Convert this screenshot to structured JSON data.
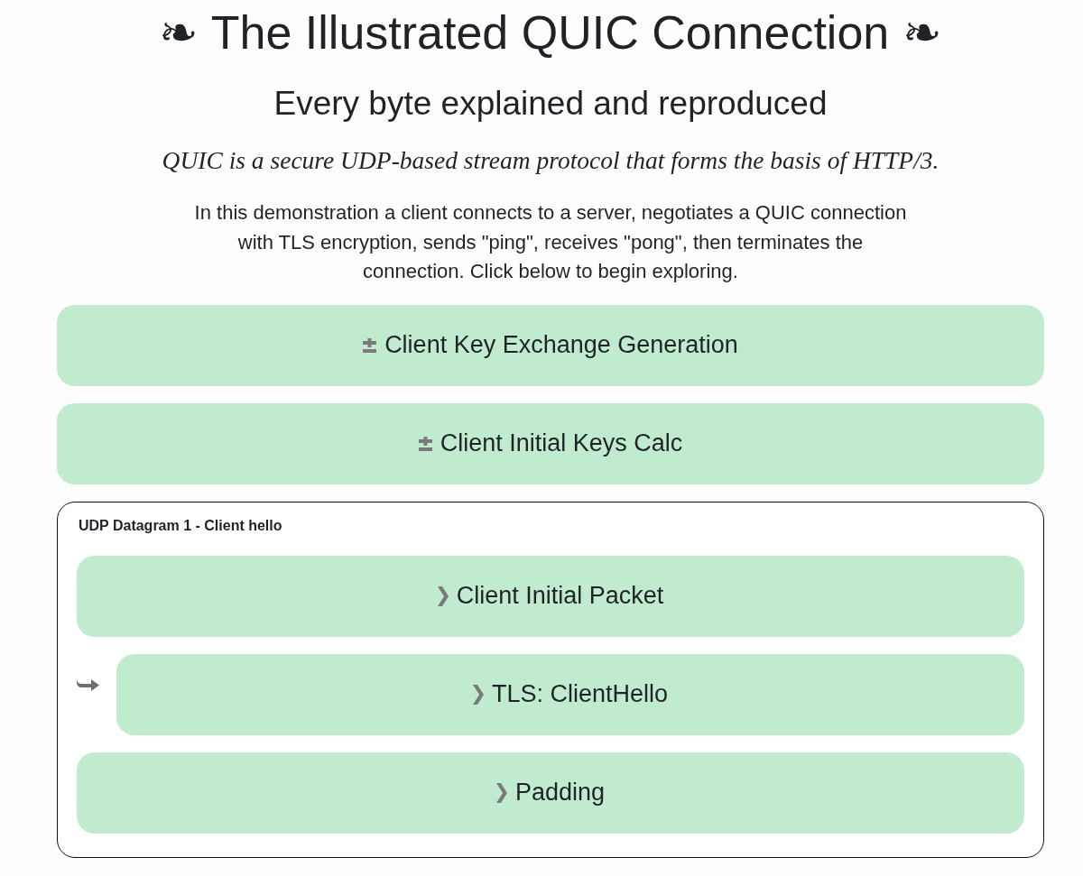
{
  "header": {
    "title": "❧ The Illustrated QUIC Connection ❧",
    "subtitle": "Every byte explained and reproduced",
    "tagline": "QUIC is a secure UDP-based stream protocol that forms the basis of HTTP/3.",
    "intro": "In this demonstration a client connects to a server, negotiates a QUIC connection with TLS encryption, sends \"ping\", receives \"pong\", then terminates the connection. Click below to begin exploring."
  },
  "sections": [
    {
      "kind": "calculation",
      "label": "Client Key Exchange Generation"
    },
    {
      "kind": "calculation",
      "label": "Client Initial Keys Calc"
    },
    {
      "kind": "datagram",
      "label": "UDP Datagram 1 - Client hello",
      "records": [
        {
          "label": "Client Initial Packet",
          "expanded": false,
          "children": [
            {
              "label": "TLS: ClientHello",
              "expanded": false
            }
          ]
        },
        {
          "label": "Padding",
          "expanded": false
        }
      ]
    }
  ]
}
